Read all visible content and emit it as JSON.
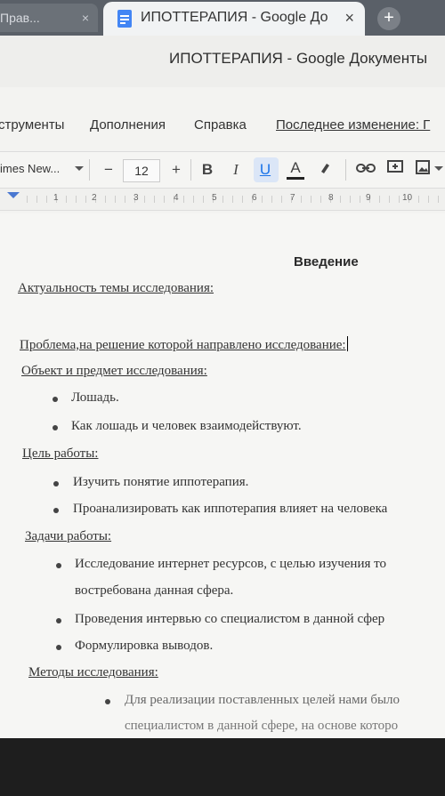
{
  "tabs": {
    "prev_tab_label": "Прав...",
    "active_tab_label": "ИПОТТЕРАПИЯ - Google До",
    "close_glyph": "×",
    "new_tab_glyph": "+"
  },
  "window": {
    "title": "ИПОТТЕРАПИЯ - Google Документы"
  },
  "menu": {
    "items": [
      "струменты",
      "Дополнения",
      "Справка"
    ],
    "last_edit": "Последнее изменение: Г"
  },
  "toolbar": {
    "font_name": "imes New...",
    "minus": "−",
    "font_size": "12",
    "plus": "+",
    "bold": "B",
    "italic": "I",
    "underline": "U",
    "text_color": "A",
    "icons": [
      "highlight-icon",
      "link-icon",
      "comment-icon",
      "image-icon"
    ]
  },
  "ruler": {
    "numbers": [
      "1",
      "2",
      "3",
      "4",
      "5",
      "6",
      "7",
      "8",
      "9",
      "10"
    ]
  },
  "document": {
    "heading": "Введение",
    "relevance": "Актуальность темы исследования:",
    "problem": "Проблема,на решение которой направлено исследование:",
    "object_subject": "Объект и предмет исследования:",
    "object_items": [
      "Лошадь.",
      "Как лошадь и человек взаимодействуют."
    ],
    "goal_title": "Цель работы:",
    "goal_items": [
      "Изучить понятие иппотерапия.",
      "Проанализировать как иппотерапия влияет на человека"
    ],
    "tasks_title": "Задачи работы:",
    "tasks_items": [
      "Исследование интернет ресурсов, с целью изучения то",
      "востребована данная сфера.",
      "Проведения интервью со специалистом в данной сфер",
      "Формулировка выводов."
    ],
    "methods_title": "Методы исследования:",
    "methods_items": [
      "Для реализации поставленных целей нами было",
      "специалистом в данной сфере, на основе которо"
    ]
  }
}
